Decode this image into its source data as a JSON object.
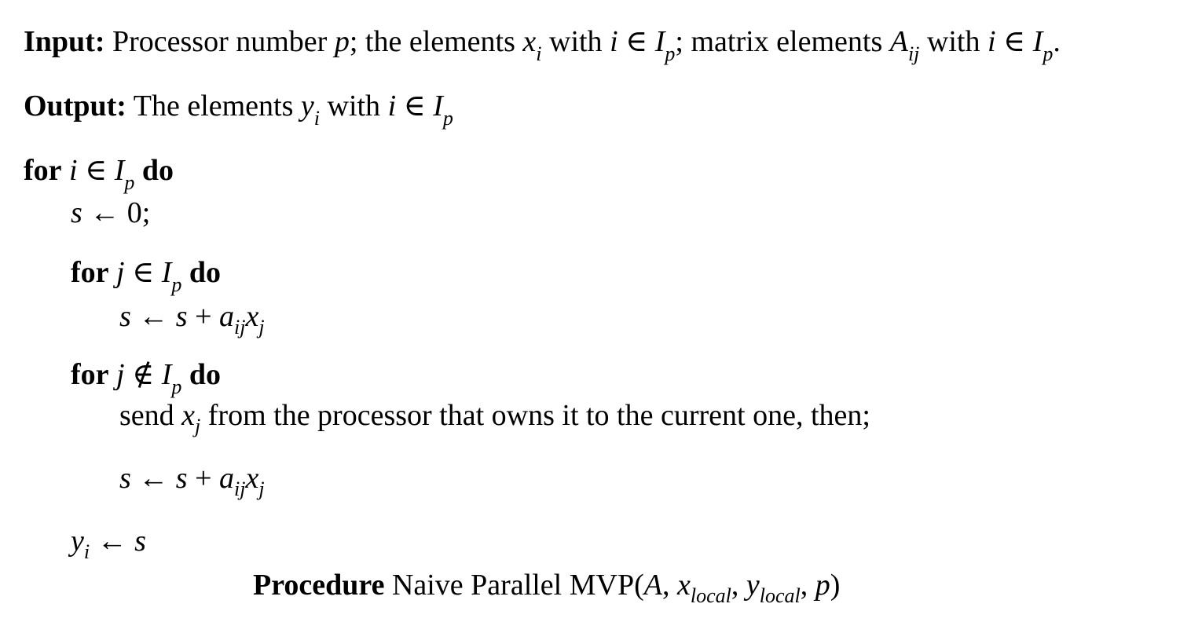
{
  "input": {
    "label": "Input:",
    "t1": "Processor number",
    "p": "p",
    "t2": "; the elements",
    "x": "x",
    "x_sub": "i",
    "t3": "with",
    "i": "i",
    "in": "∈",
    "I": "I",
    "I_sub": "p",
    "t4": "; matrix elements",
    "A": "A",
    "A_sub": "ij",
    "t5": "with",
    "i2": "i",
    "in2": "∈",
    "I2": "I",
    "I2_sub": "p",
    "end": "."
  },
  "output": {
    "label": "Output:",
    "t1": "The elements",
    "y": "y",
    "y_sub": "i",
    "t2": "with",
    "i": "i",
    "in": "∈",
    "I": "I",
    "I_sub": "p"
  },
  "loop1": {
    "kw_for": "for",
    "var": "i",
    "in": "∈",
    "I": "I",
    "I_sub": "p",
    "kw_do": "do"
  },
  "assign_s0": {
    "s": "s",
    "arrow": "←",
    "val": "0;"
  },
  "loop2": {
    "kw_for": "for",
    "var": "j",
    "in": "∈",
    "I": "I",
    "I_sub": "p",
    "kw_do": "do"
  },
  "update1": {
    "s": "s",
    "arrow": "←",
    "s2": "s",
    "plus": "+",
    "a": "a",
    "a_sub": "ij",
    "x": "x",
    "x_sub": "j"
  },
  "loop3": {
    "kw_for": "for",
    "var": "j",
    "notin": "∉",
    "I": "I",
    "I_sub": "p",
    "kw_do": "do"
  },
  "send": {
    "t1": "send",
    "x": "x",
    "x_sub": "j",
    "t2": "from the processor that owns it to the current one, then;"
  },
  "update2": {
    "s": "s",
    "arrow": "←",
    "s2": "s",
    "plus": "+",
    "a": "a",
    "a_sub": "ij",
    "x": "x",
    "x_sub": "j"
  },
  "assign_y": {
    "y": "y",
    "y_sub": "i",
    "arrow": "←",
    "s": "s"
  },
  "caption": {
    "kw": "Procedure",
    "name": "Naive Parallel MVP(",
    "A": "A",
    "comma1": ", ",
    "x": "x",
    "x_sub": "local",
    "comma2": ", ",
    "y": "y",
    "y_sub": "local",
    "comma3": ", ",
    "p": "p",
    "close": ")"
  }
}
